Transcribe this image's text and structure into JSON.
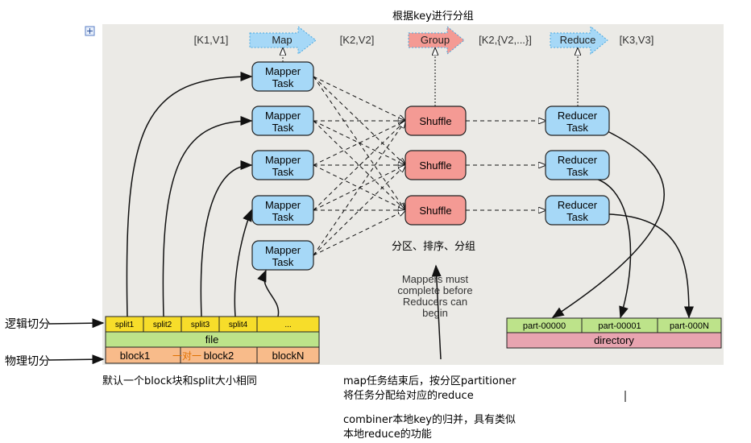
{
  "top_note": "根据key进行分组",
  "flow": {
    "k1v1": "[K1,V1]",
    "map": "Map",
    "k2v2": "[K2,V2]",
    "group": "Group",
    "k2list": "[K2,{V2,...}]",
    "reduce": "Reduce",
    "k3v3": "[K3,V3]"
  },
  "mapper_line1": "Mapper",
  "mapper_line2": "Task",
  "shuffle": "Shuffle",
  "reducer_line1": "Reducer",
  "reducer_line2": "Task",
  "shuffle_note": "分区、排序、分组",
  "mappers_note": [
    "Mappers must",
    "complete before",
    "Reducers can",
    "begin"
  ],
  "splits": [
    "split1",
    "split2",
    "split3",
    "split4",
    "..."
  ],
  "file": "file",
  "blocks": [
    "block1",
    "block2",
    "blockN"
  ],
  "one_to_one": "一对一",
  "parts": [
    "part-00000",
    "part-00001",
    "part-000N"
  ],
  "directory": "directory",
  "logical_split": "逻辑切分",
  "physical_split": "物理切分",
  "block_note": "默认一个block块和split大小相同",
  "partition_note": [
    "map任务结束后，按分区partitioner",
    "将任务分配给对应的reduce"
  ],
  "combiner_note": [
    "combiner本地key的归并，具有类似",
    "本地reduce的功能"
  ],
  "colors": {
    "mapper": "#a6d8f7",
    "shuffle": "#f49a94",
    "split": "#f7dd2a",
    "file": "#bde38a",
    "block": "#f8bb8a",
    "directory": "#e8a4b0",
    "panel": "#ebeae6"
  }
}
